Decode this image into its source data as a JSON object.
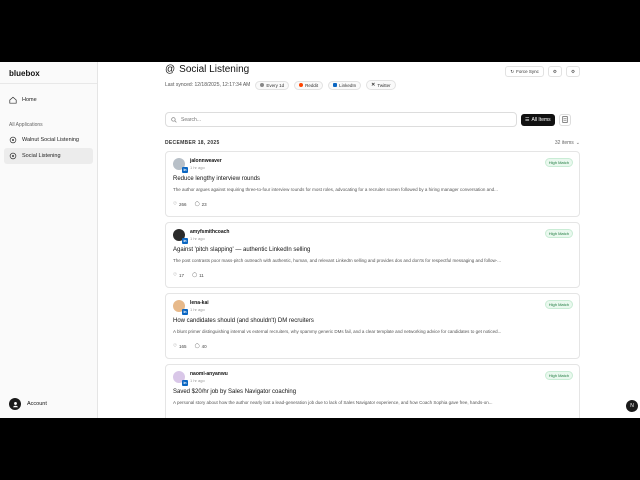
{
  "app": {
    "brand": "bluebox"
  },
  "sidebar": {
    "home_label": "Home",
    "section_label": "All Applications",
    "items": [
      {
        "label": "Walnut Social Listening"
      },
      {
        "label": "Social Listening"
      }
    ],
    "account_label": "Account"
  },
  "header": {
    "title": "Social Listening",
    "last_synced": "Last synced: 12/18/2025, 12:17:34 AM",
    "chips": [
      {
        "label": "Every 1d",
        "color": "#888888"
      },
      {
        "label": "Reddit",
        "color": "#ff4500"
      },
      {
        "label": "LinkedIn",
        "color": "#0a66c2"
      },
      {
        "label": "Twitter",
        "color": "#111111"
      }
    ],
    "force_sync_label": "Force Sync"
  },
  "search": {
    "placeholder": "Search...",
    "all_items_label": "All Items"
  },
  "feed": {
    "date_label": "DECEMBER 18, 2025",
    "count_label": "32 items",
    "posts": [
      {
        "author": "jalonnweaver",
        "ago": "1 hr ago",
        "badge": "High Match",
        "title": "Reduce lengthy interview rounds",
        "body": "The author argues against requiring three-to-four interview rounds for most roles, advocating for a recruiter screen followed by a hiring manager conversation and...",
        "likes": "266",
        "comments": "23",
        "avatar_color": "#b8c0c8"
      },
      {
        "author": "amyfsmithcoach",
        "ago": "1 hr ago",
        "badge": "High Match",
        "title": "Against 'pitch slapping' — authentic LinkedIn selling",
        "body": "The post contrasts poor mass-pitch outreach with authentic, human, and relevant LinkedIn selling and provides dos and don'ts for respectful messaging and follow-...",
        "likes": "17",
        "comments": "11",
        "avatar_color": "#2b2b2b"
      },
      {
        "author": "lena-kai",
        "ago": "1 hr ago",
        "badge": "High Match",
        "title": "How candidates should (and shouldn't) DM recruiters",
        "body": "A blunt primer distinguishing internal vs external recruiters, why spammy generic DMs fail, and a clear template and networking advice for candidates to get noticed...",
        "likes": "165",
        "comments": "40",
        "avatar_color": "#e7b98a"
      },
      {
        "author": "naomi-anyanwu",
        "ago": "1 hr ago",
        "badge": "High Match",
        "title": "Saved $20/hr job by Sales Navigator coaching",
        "body": "A personal story about how the author nearly lost a lead-generation job due to lack of Sales Navigator experience, and how Coach Sophia gave free, hands-on...",
        "likes": "",
        "comments": "",
        "avatar_color": "#d9c7e8"
      }
    ]
  },
  "help_label": "N"
}
